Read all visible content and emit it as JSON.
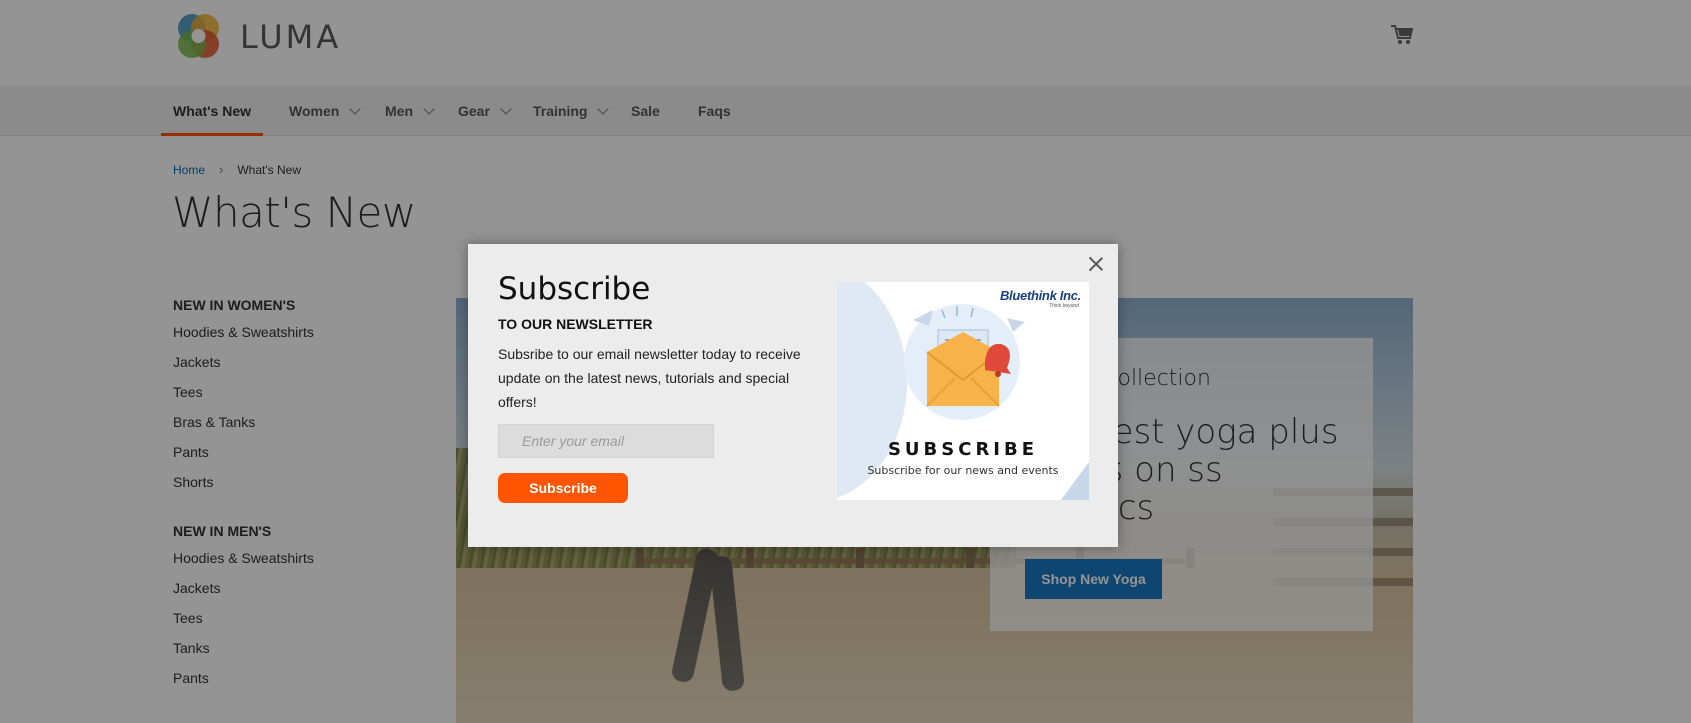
{
  "header": {
    "logo_text": "LUMA",
    "cart_icon": "cart-icon"
  },
  "nav": {
    "items": [
      {
        "label": "What's New",
        "active": true,
        "has_dropdown": false
      },
      {
        "label": "Women",
        "has_dropdown": true
      },
      {
        "label": "Men",
        "has_dropdown": true
      },
      {
        "label": "Gear",
        "has_dropdown": true
      },
      {
        "label": "Training",
        "has_dropdown": true
      },
      {
        "label": "Sale",
        "has_dropdown": false
      },
      {
        "label": "Faqs",
        "has_dropdown": false
      }
    ]
  },
  "breadcrumb": {
    "home": "Home",
    "current": "What's New"
  },
  "page": {
    "title": "What's New"
  },
  "sidebar": {
    "groups": [
      {
        "heading": "NEW IN WOMEN'S",
        "items": [
          "Hoodies & Sweatshirts",
          "Jackets",
          "Tees",
          "Bras & Tanks",
          "Pants",
          "Shorts"
        ]
      },
      {
        "heading": "NEW IN MEN'S",
        "items": [
          "Hoodies & Sweatshirts",
          "Jackets",
          "Tees",
          "Tanks",
          "Pants"
        ]
      }
    ]
  },
  "hero": {
    "subtitle": "a Yoga Collection",
    "headline": "ry latest yoga plus twists on ss classics",
    "button": "Shop New Yoga"
  },
  "modal": {
    "title": "Subscribe",
    "subtitle": "TO OUR NEWSLETTER",
    "description": "Subsribe to our email newsletter today to receive update on the latest news, tutorials and special offers!",
    "email_placeholder": "Enter your email",
    "button": "Subscribe",
    "image": {
      "brand": "Bluethink Inc.",
      "brand_tagline": "Think beyond",
      "heading": "SUBSCRIBE",
      "caption": "Subscribe for our news and events"
    }
  },
  "colors": {
    "accent": "#ff5501",
    "link": "#006bb4",
    "primary_button": "#1979c3"
  }
}
